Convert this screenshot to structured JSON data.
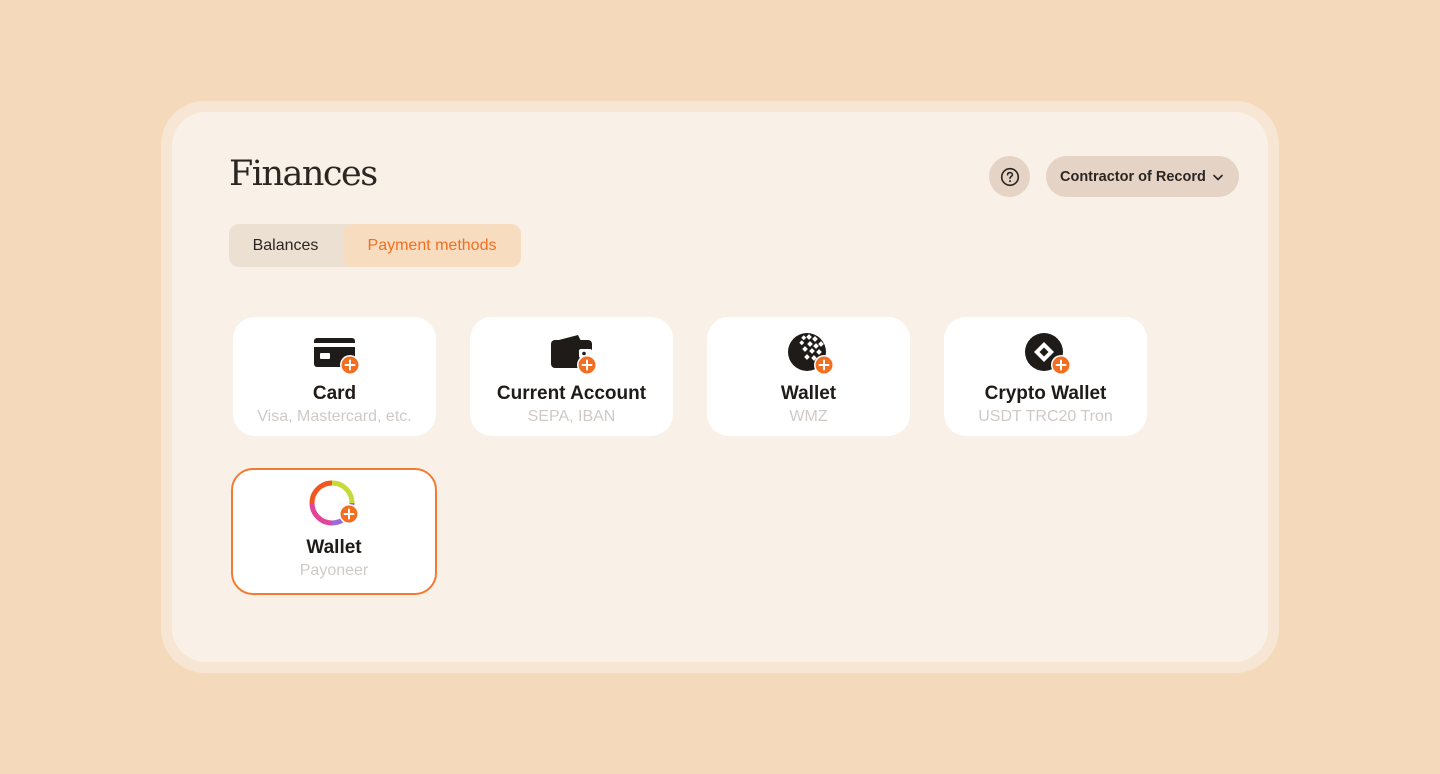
{
  "page": {
    "title": "Finances"
  },
  "header": {
    "help_icon": "question-circle-icon",
    "dropdown_label": "Contractor of Record",
    "dropdown_icon": "chevron-down-icon"
  },
  "tabs": [
    {
      "label": "Balances",
      "active": false
    },
    {
      "label": "Payment methods",
      "active": true
    }
  ],
  "payment_methods": [
    {
      "title": "Card",
      "subtitle": "Visa, Mastercard, etc.",
      "icon": "credit-card-add-icon",
      "selected": false
    },
    {
      "title": "Current Account",
      "subtitle": "SEPA, IBAN",
      "icon": "wallet-add-icon",
      "selected": false
    },
    {
      "title": "Wallet",
      "subtitle": "WMZ",
      "icon": "webmoney-globe-add-icon",
      "selected": false
    },
    {
      "title": "Crypto Wallet",
      "subtitle": "USDT TRC20 Tron",
      "icon": "crypto-diamond-add-icon",
      "selected": false
    },
    {
      "title": "Wallet",
      "subtitle": "Payoneer",
      "icon": "payoneer-ring-add-icon",
      "selected": true
    }
  ],
  "colors": {
    "background": "#f5d9bb",
    "panel": "#f9f1e7",
    "accent": "#f26f21",
    "text": "#2b2622",
    "muted": "#cfcac6"
  }
}
